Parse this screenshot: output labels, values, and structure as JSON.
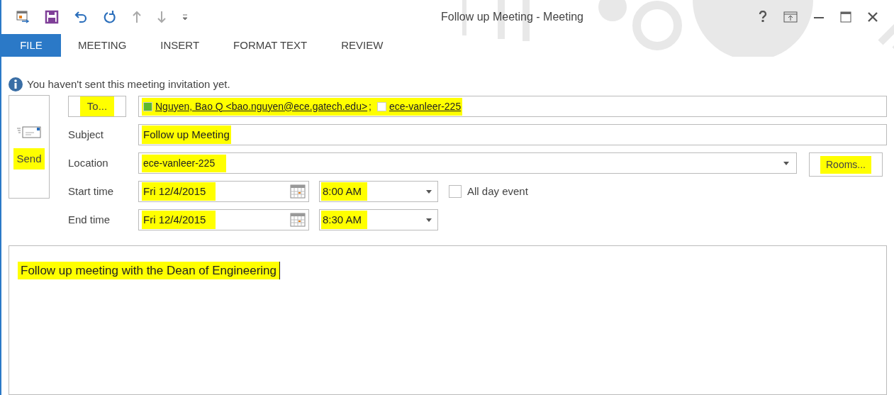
{
  "window": {
    "title": "Follow up Meeting - Meeting"
  },
  "quick_access": [
    {
      "kind": "calendar"
    },
    {
      "kind": "save"
    },
    {
      "kind": "undo"
    },
    {
      "kind": "redo"
    },
    {
      "kind": "up"
    },
    {
      "kind": "down"
    },
    {
      "kind": "customize"
    }
  ],
  "window_controls": [
    {
      "kind": "help"
    },
    {
      "kind": "ribbon"
    },
    {
      "kind": "minimize"
    },
    {
      "kind": "maximize"
    },
    {
      "kind": "close"
    }
  ],
  "tabs": [
    {
      "label": "FILE",
      "selected": true
    },
    {
      "label": "MEETING",
      "selected": false
    },
    {
      "label": "INSERT",
      "selected": false
    },
    {
      "label": "FORMAT TEXT",
      "selected": false
    },
    {
      "label": "REVIEW",
      "selected": false
    }
  ],
  "info_bar": {
    "text": "You haven't sent this meeting invitation yet."
  },
  "send_button": {
    "label": "Send",
    "highlighted": true
  },
  "to_button": {
    "label": "To...",
    "highlighted": true
  },
  "recipients": [
    {
      "name": "Nguyen, Bao Q <bao.nguyen@ece.gatech.edu>",
      "color": "#5cb82e",
      "separator": ";"
    },
    {
      "name": "ece-vanleer-225",
      "color": "#ffffff"
    }
  ],
  "subject": {
    "label": "Subject",
    "value": "Follow up Meeting",
    "highlighted": true
  },
  "location": {
    "label": "Location",
    "value": "ece-vanleer-225",
    "highlighted": true
  },
  "rooms_button": {
    "label": "Rooms...",
    "highlighted": true
  },
  "start": {
    "label": "Start time",
    "date": "Fri 12/4/2015",
    "time": "8:00 AM",
    "highlighted": true
  },
  "end": {
    "label": "End time",
    "date": "Fri 12/4/2015",
    "time": "8:30 AM",
    "highlighted": true
  },
  "all_day": {
    "label": "All day event",
    "checked": false
  },
  "body": {
    "text": "Follow up meeting with the Dean of Engineering",
    "highlighted": true
  }
}
